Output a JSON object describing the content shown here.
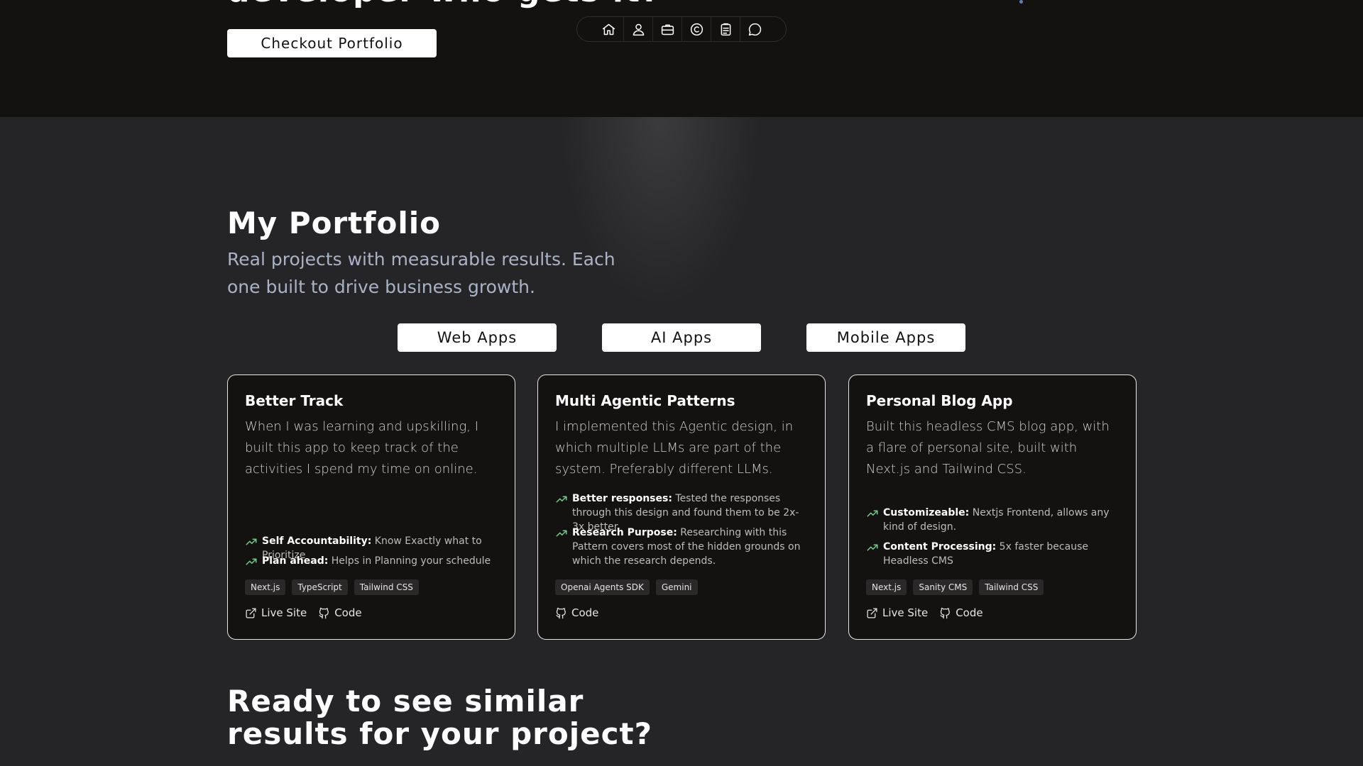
{
  "hero": {
    "title_fragment": "developer who gets it?",
    "cta_label": "Checkout Portfolio"
  },
  "nav": {
    "items": [
      {
        "icon": "home-icon"
      },
      {
        "icon": "user-icon"
      },
      {
        "icon": "briefcase-icon"
      },
      {
        "icon": "copyright-icon"
      },
      {
        "icon": "clipboard-icon"
      },
      {
        "icon": "message-icon"
      }
    ]
  },
  "portfolio": {
    "title": "My Portfolio",
    "subtitle": "Real projects with measurable results. Each one built to drive business growth.",
    "filters": [
      "Web Apps",
      "AI Apps",
      "Mobile Apps"
    ],
    "cards": [
      {
        "title": "Better Track",
        "description": "When I was learning and upskilling, I built this app to keep track of the activities I spend my time on online.",
        "features": [
          {
            "label": "Self Accountability:",
            "text": "Know Exactly what to Prioritize"
          },
          {
            "label": "Plan ahead:",
            "text": "Helps in Planning your schedule"
          }
        ],
        "tags": [
          "Next.js",
          "TypeScript",
          "Tailwind CSS"
        ],
        "live_label": "Live Site",
        "code_label": "Code"
      },
      {
        "title": "Multi Agentic Patterns",
        "description": "I implemented this Agentic design, in which multiple LLMs are part of the system. Preferably different LLMs.",
        "features": [
          {
            "label": "Better responses:",
            "text": "Tested the responses through this design and found them to be 2x-3x better."
          },
          {
            "label": "Research Purpose:",
            "text": "Researching with this Pattern covers most of the hidden grounds on which the research depends."
          }
        ],
        "tags": [
          "Openai Agents SDK",
          "Gemini"
        ],
        "code_label": "Code"
      },
      {
        "title": "Personal Blog App",
        "description": "Built this headless CMS blog app, with a flare of personal site, built with Next.js and Tailwind CSS.",
        "features": [
          {
            "label": "Customizeable:",
            "text": "Nextjs Frontend, allows any kind of design."
          },
          {
            "label": "Content Processing:",
            "text": "5x faster because Headless CMS"
          }
        ],
        "tags": [
          "Next.js",
          "Sanity CMS",
          "Tailwind CSS"
        ],
        "live_label": "Live Site",
        "code_label": "Code"
      }
    ]
  },
  "cta": {
    "line1": "Ready to see similar",
    "line2": "results for your project?"
  },
  "colors": {
    "top_band": "#141111",
    "section_bg": "#252527",
    "card_bg": "#141111",
    "subtitle": "#a9b3c7",
    "trend_icon": "#6fcf8a"
  }
}
